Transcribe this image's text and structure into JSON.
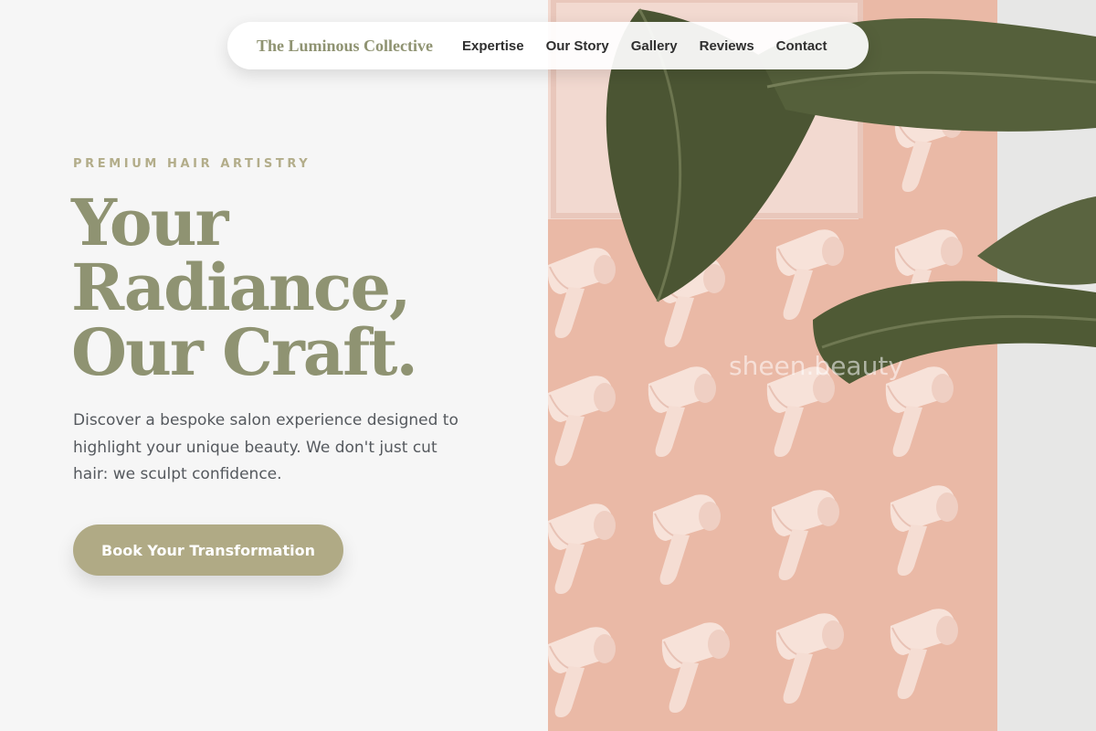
{
  "nav": {
    "brand": "The Luminous Collective",
    "links": [
      "Expertise",
      "Our Story",
      "Gallery",
      "Reviews",
      "Contact"
    ]
  },
  "hero": {
    "eyebrow": "PREMIUM HAIR ARTISTRY",
    "headline": [
      "Your",
      "Radiance,",
      "Our Craft."
    ],
    "description": "Discover a bespoke salon experience designed to highlight your unique beauty. We don't just cut hair: we sculpt confidence.",
    "cta_label": "Book Your Transformation"
  },
  "photo": {
    "watermark": "sheen.beauty",
    "colors": {
      "wall": "#eab9a6",
      "dryer": "#f6dcd2",
      "leaf": "#4b5533",
      "right_wall": "#e6e6e6"
    }
  },
  "colors": {
    "accent": "#8f9372",
    "eyebrow": "#b3ad8a",
    "button": "#b0aa85",
    "text": "#55595e",
    "background": "#f6f6f6"
  }
}
